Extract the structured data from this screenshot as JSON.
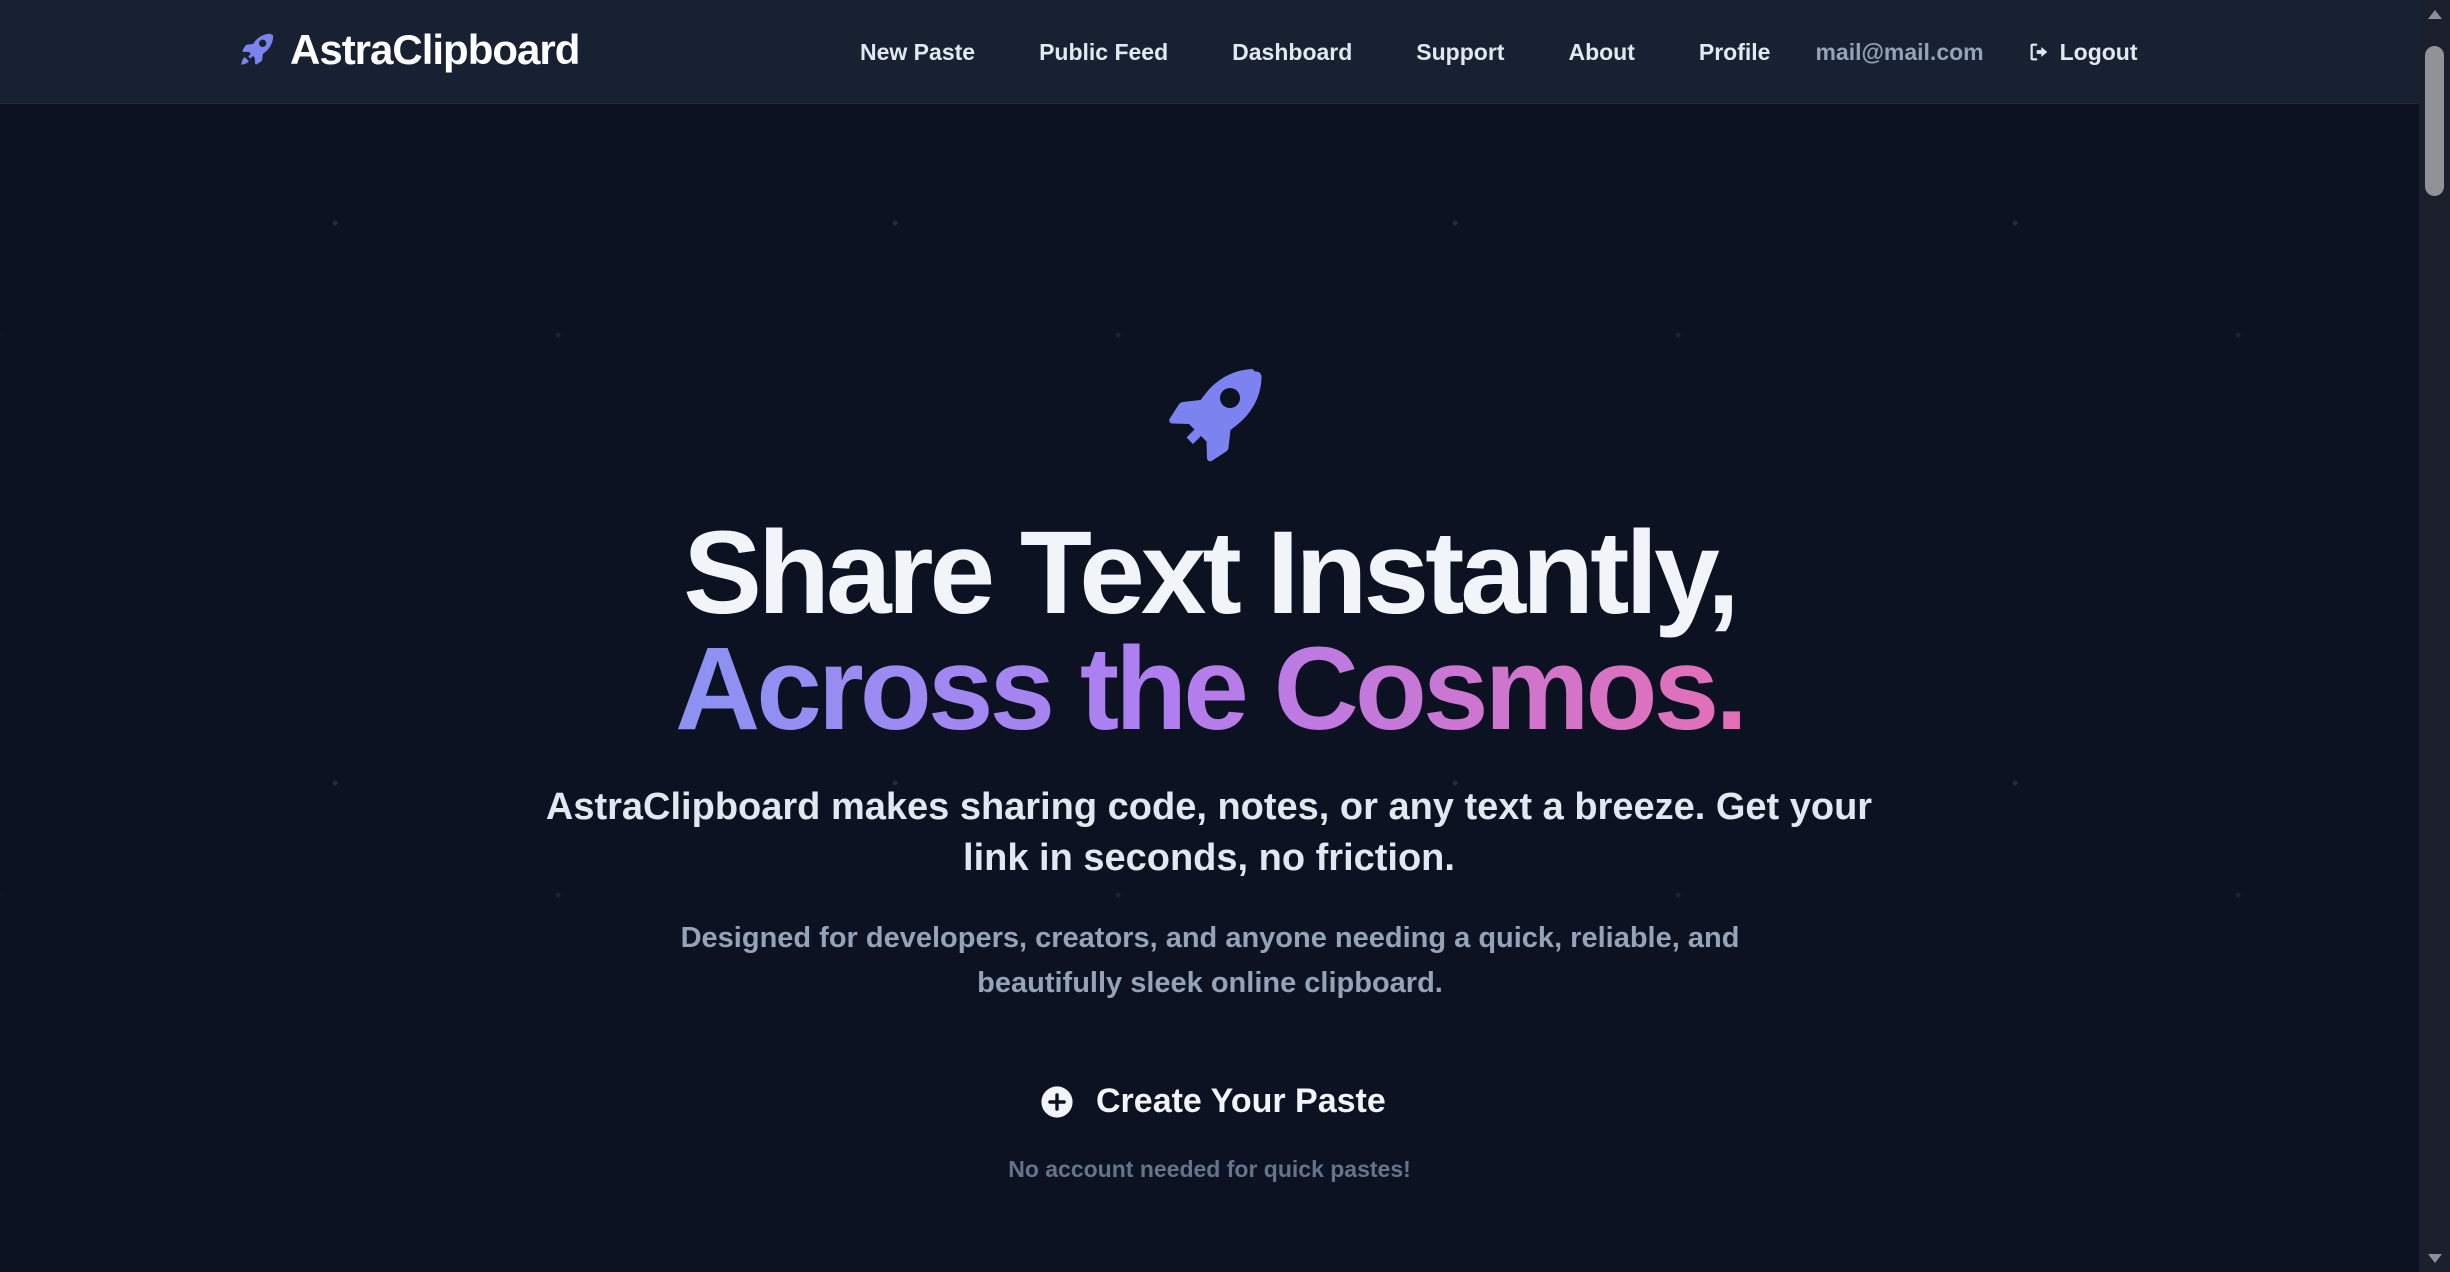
{
  "brand": {
    "name": "AstraClipboard",
    "icon": "rocket-icon",
    "accent_color": "#7c83f0"
  },
  "nav": {
    "items": [
      {
        "label": "New Paste"
      },
      {
        "label": "Public Feed"
      },
      {
        "label": "Dashboard"
      },
      {
        "label": "Support"
      },
      {
        "label": "About"
      },
      {
        "label": "Profile"
      }
    ],
    "user_email": "mail@mail.com",
    "logout_label": "Logout",
    "logout_icon": "logout-icon"
  },
  "hero": {
    "icon": "rocket-icon",
    "headline_line1": "Share Text Instantly,",
    "headline_line2": "Across the Cosmos.",
    "lead": "AstraClipboard makes sharing code, notes, or any text a breeze. Get your link in seconds, no friction.",
    "sublead": "Designed for developers, creators, and anyone needing a quick, reliable, and beautifully sleek online clipboard.",
    "cta_label": "Create Your Paste",
    "cta_icon": "plus-circle-icon",
    "cta_note": "No account needed for quick pastes!"
  },
  "colors": {
    "background": "#0c1221",
    "navbar": "#172132",
    "gradient_start": "#8b93f2",
    "gradient_mid": "#b07ef0",
    "gradient_end": "#e46fb5"
  }
}
